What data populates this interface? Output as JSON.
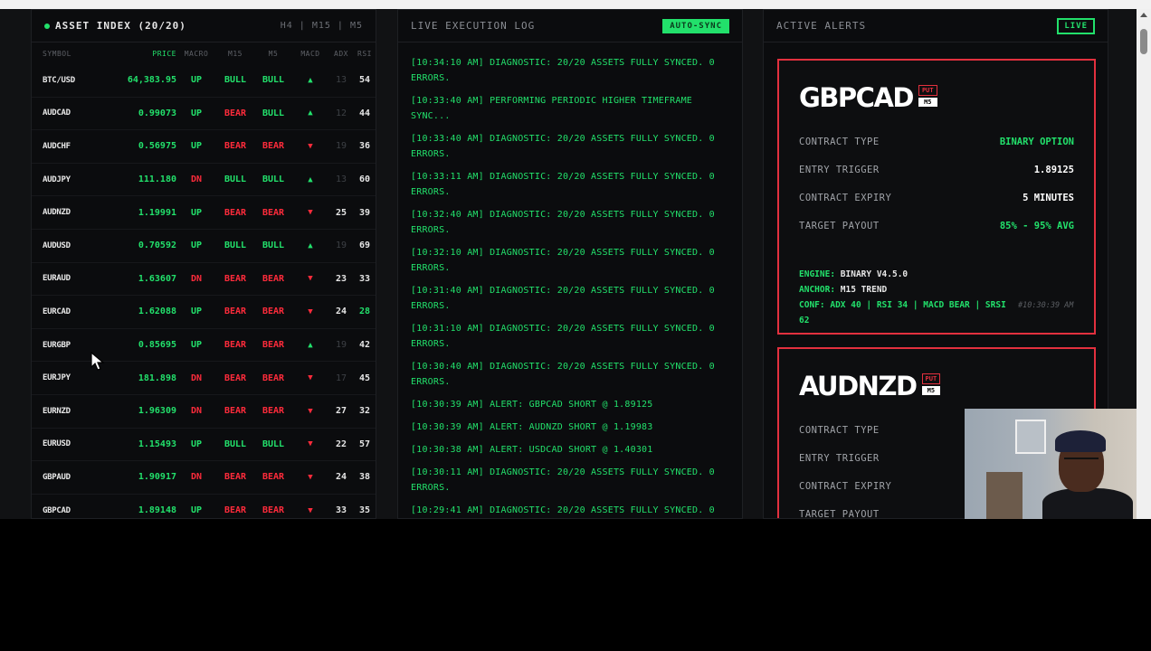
{
  "asset_index": {
    "title": "ASSET INDEX (20/20)",
    "timeframes": "H4 | M15 | M5",
    "columns": [
      "SYMBOL",
      "PRICE",
      "MACRO",
      "M15",
      "M5",
      "MACD",
      "ADX",
      "RSI"
    ],
    "rows": [
      {
        "symbol": "BTC/USD",
        "price": "64,383.95",
        "macro": "UP",
        "m15": "BULL",
        "m5": "BULL",
        "macd": "up",
        "adx": "13",
        "adx_dim": true,
        "rsi": "54"
      },
      {
        "symbol": "AUDCAD",
        "price": "0.99073",
        "macro": "UP",
        "m15": "BEAR",
        "m5": "BULL",
        "macd": "up",
        "adx": "12",
        "adx_dim": true,
        "rsi": "44"
      },
      {
        "symbol": "AUDCHF",
        "price": "0.56975",
        "macro": "UP",
        "m15": "BEAR",
        "m5": "BEAR",
        "macd": "down",
        "adx": "19",
        "adx_dim": true,
        "rsi": "36"
      },
      {
        "symbol": "AUDJPY",
        "price": "111.180",
        "macro": "DN",
        "m15": "BULL",
        "m5": "BULL",
        "macd": "up",
        "adx": "13",
        "adx_dim": true,
        "rsi": "60"
      },
      {
        "symbol": "AUDNZD",
        "price": "1.19991",
        "macro": "UP",
        "m15": "BEAR",
        "m5": "BEAR",
        "macd": "down",
        "adx": "25",
        "adx_dim": false,
        "rsi": "39"
      },
      {
        "symbol": "AUDUSD",
        "price": "0.70592",
        "macro": "UP",
        "m15": "BULL",
        "m5": "BULL",
        "macd": "up",
        "adx": "19",
        "adx_dim": true,
        "rsi": "69"
      },
      {
        "symbol": "EURAUD",
        "price": "1.63607",
        "macro": "DN",
        "m15": "BEAR",
        "m5": "BEAR",
        "macd": "down",
        "adx": "23",
        "adx_dim": false,
        "rsi": "33"
      },
      {
        "symbol": "EURCAD",
        "price": "1.62088",
        "macro": "UP",
        "m15": "BEAR",
        "m5": "BEAR",
        "macd": "down",
        "adx": "24",
        "adx_dim": false,
        "rsi": "28",
        "rsi_green": true
      },
      {
        "symbol": "EURGBP",
        "price": "0.85695",
        "macro": "UP",
        "m15": "BEAR",
        "m5": "BEAR",
        "macd": "up",
        "adx": "19",
        "adx_dim": true,
        "rsi": "42"
      },
      {
        "symbol": "EURJPY",
        "price": "181.898",
        "macro": "DN",
        "m15": "BEAR",
        "m5": "BEAR",
        "macd": "down",
        "adx": "17",
        "adx_dim": true,
        "rsi": "45"
      },
      {
        "symbol": "EURNZD",
        "price": "1.96309",
        "macro": "DN",
        "m15": "BEAR",
        "m5": "BEAR",
        "macd": "down",
        "adx": "27",
        "adx_dim": false,
        "rsi": "32"
      },
      {
        "symbol": "EURUSD",
        "price": "1.15493",
        "macro": "UP",
        "m15": "BULL",
        "m5": "BULL",
        "macd": "down",
        "adx": "22",
        "adx_dim": false,
        "rsi": "57"
      },
      {
        "symbol": "GBPAUD",
        "price": "1.90917",
        "macro": "DN",
        "m15": "BEAR",
        "m5": "BEAR",
        "macd": "down",
        "adx": "24",
        "adx_dim": false,
        "rsi": "38"
      },
      {
        "symbol": "GBPCAD",
        "price": "1.89148",
        "macro": "UP",
        "m15": "BEAR",
        "m5": "BEAR",
        "macd": "down",
        "adx": "33",
        "adx_dim": false,
        "rsi": "35"
      }
    ]
  },
  "log": {
    "title": "LIVE EXECUTION LOG",
    "badge": "AUTO-SYNC",
    "entries": [
      "[10:34:10 AM] DIAGNOSTIC: 20/20 ASSETS FULLY SYNCED. 0 ERRORS.",
      "[10:33:40 AM] PERFORMING PERIODIC HIGHER TIMEFRAME SYNC...",
      "[10:33:40 AM] DIAGNOSTIC: 20/20 ASSETS FULLY SYNCED. 0 ERRORS.",
      "[10:33:11 AM] DIAGNOSTIC: 20/20 ASSETS FULLY SYNCED. 0 ERRORS.",
      "[10:32:40 AM] DIAGNOSTIC: 20/20 ASSETS FULLY SYNCED. 0 ERRORS.",
      "[10:32:10 AM] DIAGNOSTIC: 20/20 ASSETS FULLY SYNCED. 0 ERRORS.",
      "[10:31:40 AM] DIAGNOSTIC: 20/20 ASSETS FULLY SYNCED. 0 ERRORS.",
      "[10:31:10 AM] DIAGNOSTIC: 20/20 ASSETS FULLY SYNCED. 0 ERRORS.",
      "[10:30:40 AM] DIAGNOSTIC: 20/20 ASSETS FULLY SYNCED. 0 ERRORS.",
      "[10:30:39 AM] ALERT: GBPCAD SHORT @ 1.89125",
      "[10:30:39 AM] ALERT: AUDNZD SHORT @ 1.19983",
      "[10:30:38 AM] ALERT: USDCAD SHORT @ 1.40301",
      "[10:30:11 AM] DIAGNOSTIC: 20/20 ASSETS FULLY SYNCED. 0 ERRORS.",
      "[10:29:41 AM] DIAGNOSTIC: 20/20 ASSETS FULLY SYNCED. 0"
    ]
  },
  "alerts": {
    "title": "ACTIVE ALERTS",
    "badge": "LIVE",
    "cards": [
      {
        "pair": "GBPCAD",
        "direction": "PUT",
        "timeframe": "M5",
        "fields": [
          {
            "label": "CONTRACT TYPE",
            "value": "BINARY OPTION",
            "green": true
          },
          {
            "label": "ENTRY TRIGGER",
            "value": "1.89125",
            "green": false
          },
          {
            "label": "CONTRACT EXPIRY",
            "value": "5 MINUTES",
            "green": false
          },
          {
            "label": "TARGET PAYOUT",
            "value": "85% - 95% AVG",
            "green": true
          }
        ],
        "engine_label": "ENGINE:",
        "engine_value": "BINARY V4.5.0",
        "anchor_label": "ANCHOR:",
        "anchor_value": "M15 TREND",
        "conf_label": "CONF:",
        "conf_value": "ADX 40 | RSI 34 | MACD BEAR | SRSI 62",
        "timestamp": "#10:30:39 AM"
      },
      {
        "pair": "AUDNZD",
        "direction": "PUT",
        "timeframe": "M5",
        "fields": [
          {
            "label": "CONTRACT TYPE",
            "value": "",
            "green": false
          },
          {
            "label": "ENTRY TRIGGER",
            "value": "",
            "green": false
          },
          {
            "label": "CONTRACT EXPIRY",
            "value": "",
            "green": false
          },
          {
            "label": "TARGET PAYOUT",
            "value": "",
            "green": false
          }
        ]
      }
    ]
  }
}
